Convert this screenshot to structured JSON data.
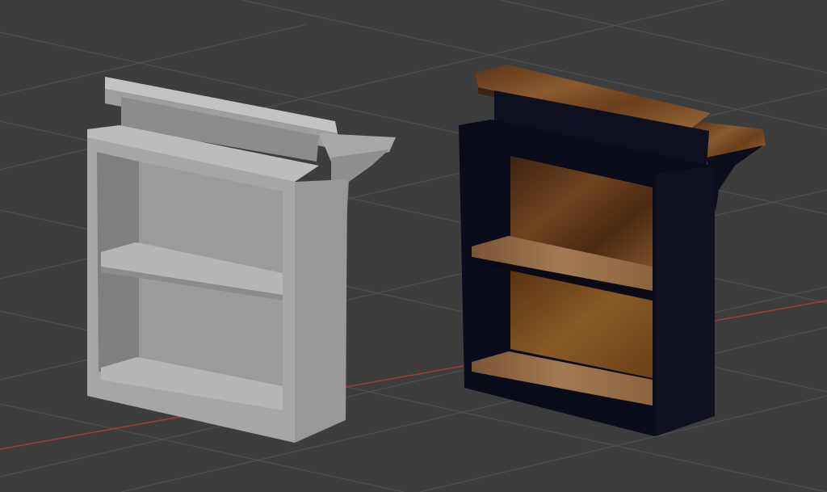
{
  "viewport": {
    "background": "#3d3d3d",
    "grid_color": "#4f4f4f",
    "x_axis_color": "#a33a3a",
    "show_grid": true
  },
  "objects": [
    {
      "name": "bookshelf-bar",
      "display_mode": "solid",
      "material": "none",
      "base_color": "#a6a6a6"
    },
    {
      "name": "bookshelf-bar",
      "display_mode": "material-preview",
      "material": "dark-wood-frame-with-oak-planks",
      "frame_color": "#0a0b18",
      "wood_color": "#7a4a24"
    }
  ]
}
